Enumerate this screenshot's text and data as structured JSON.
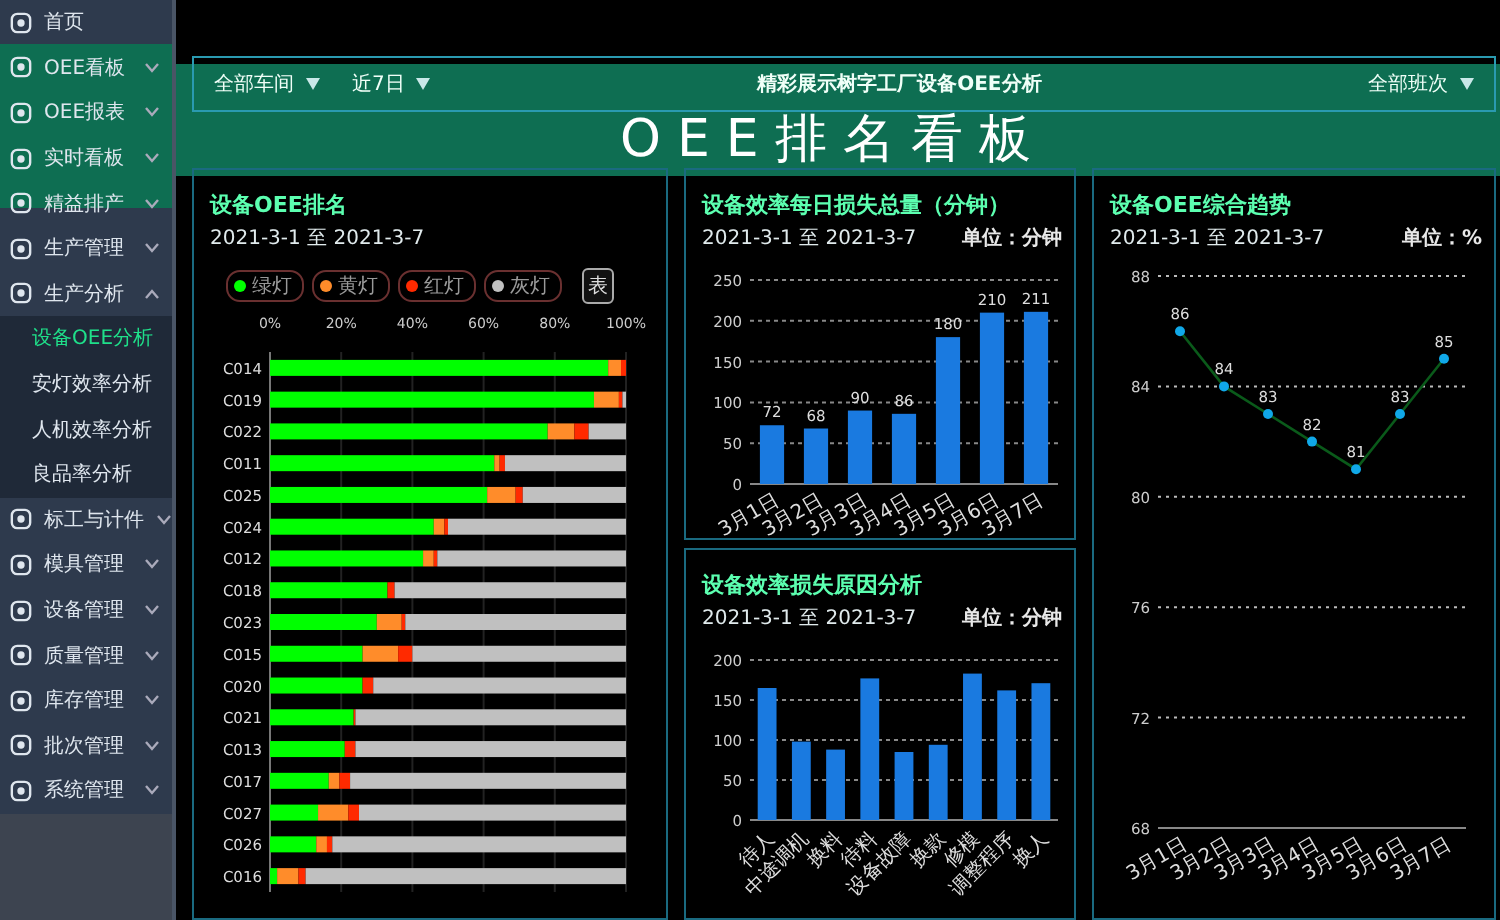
{
  "sidebar": {
    "items": [
      {
        "label": "首页",
        "selected": false
      },
      {
        "label": "OEE看板",
        "selected": false,
        "expanded": false
      },
      {
        "label": "OEE报表",
        "selected": false,
        "expanded": false
      },
      {
        "label": "实时看板",
        "selected": false,
        "expanded": false
      },
      {
        "label": "精益排产",
        "selected": false,
        "expanded": false
      },
      {
        "label": "生产管理",
        "selected": false,
        "expanded": false
      },
      {
        "label": "生产分析",
        "selected": false,
        "expanded": true,
        "children": [
          {
            "label": "设备OEE分析",
            "selected": true
          },
          {
            "label": "安灯效率分析",
            "selected": false
          },
          {
            "label": "人机效率分析",
            "selected": false
          },
          {
            "label": "良品率分析",
            "selected": false
          }
        ]
      },
      {
        "label": "标工与计件",
        "selected": false,
        "expanded": false
      },
      {
        "label": "模具管理",
        "selected": false,
        "expanded": false
      },
      {
        "label": "设备管理",
        "selected": false,
        "expanded": false
      },
      {
        "label": "质量管理",
        "selected": false,
        "expanded": false
      },
      {
        "label": "库存管理",
        "selected": false,
        "expanded": false
      },
      {
        "label": "批次管理",
        "selected": false,
        "expanded": false
      },
      {
        "label": "系统管理",
        "selected": false,
        "expanded": false
      }
    ]
  },
  "banner": {
    "title": "OEE排名看板"
  },
  "header": {
    "filters": [
      {
        "label": "全部车间"
      },
      {
        "label": "近7日"
      }
    ],
    "title": "精彩展示树字工厂设备OEE分析",
    "right_filter": {
      "label": "全部班次"
    }
  },
  "panels": {
    "ranking": {
      "title": "设备OEE排名",
      "date_range": "2021-3-1 至 2021-3-7",
      "table_button": "表",
      "chart_data": {
        "type": "bar",
        "orientation": "horizontal",
        "stacked": true,
        "categories": [
          "C014",
          "C019",
          "C022",
          "C011",
          "C025",
          "C024",
          "C012",
          "C018",
          "C023",
          "C015",
          "C020",
          "C021",
          "C013",
          "C017",
          "C027",
          "C026",
          "C016"
        ],
        "xlim": [
          0,
          100
        ],
        "grid": true,
        "xticks": [
          {
            "value": 0,
            "label": "0%"
          },
          {
            "value": 20,
            "label": "20%"
          },
          {
            "value": 40,
            "label": "40%"
          },
          {
            "value": 60,
            "label": "60%"
          },
          {
            "value": 80,
            "label": "80%"
          },
          {
            "value": 100,
            "label": "100%"
          }
        ],
        "series": [
          {
            "name": "绿灯",
            "color": "#00ff00",
            "values": [
              95,
              91,
              78,
              63,
              61,
              46,
              43,
              33,
              30,
              26,
              26,
              23.5,
              21,
              16.5,
              13.5,
              13,
              2
            ]
          },
          {
            "name": "黄灯",
            "color": "#ff8c2a",
            "values": [
              3.6,
              7,
              7.5,
              1.5,
              8,
              3,
              3,
              0,
              7,
              10,
              0,
              0,
              0,
              3,
              8.5,
              3,
              6
            ]
          },
          {
            "name": "红灯",
            "color": "#ff2a00",
            "values": [
              1.4,
              1,
              4,
              1.5,
              2,
              1,
              1,
              2,
              1,
              4,
              3,
              0.5,
              3,
              3,
              3,
              1.5,
              2
            ]
          },
          {
            "name": "灰灯",
            "color": "#c0c0c0",
            "values": [
              0,
              1,
              10.5,
              34,
              29,
              50,
              53,
              65,
              62,
              60,
              71,
              76,
              76,
              77.5,
              75,
              82.5,
              90
            ]
          }
        ]
      }
    },
    "daily_loss": {
      "title": "设备效率每日损失总量（分钟）",
      "date_range": "2021-3-1 至 2021-3-7",
      "unit": "单位：分钟",
      "chart_data": {
        "type": "bar",
        "categories": [
          "3月1日",
          "3月2日",
          "3月3日",
          "3月4日",
          "3月5日",
          "3月6日",
          "3月7日"
        ],
        "values": [
          72,
          68,
          90,
          86,
          180,
          210,
          211
        ],
        "grid": true,
        "ylim": [
          0,
          250
        ],
        "yticks": [
          0,
          50,
          100,
          150,
          200,
          250
        ],
        "data_labels": true
      }
    },
    "loss_reasons": {
      "title": "设备效率损失原因分析",
      "date_range": "2021-3-1 至 2021-3-7",
      "unit": "单位：分钟",
      "chart_data": {
        "type": "bar",
        "categories": [
          "待人",
          "中途调机",
          "换料",
          "待料",
          "设备故障",
          "换款",
          "修模",
          "调整程序",
          "换人"
        ],
        "values": [
          165,
          98,
          88,
          177,
          85,
          94,
          183,
          162,
          171
        ],
        "grid": true,
        "ylim": [
          0,
          200
        ],
        "yticks": [
          0,
          50,
          100,
          150,
          200
        ]
      }
    },
    "trend": {
      "title": "设备OEE综合趋势",
      "date_range": "2021-3-1 至 2021-3-7",
      "unit": "单位：%",
      "chart_data": {
        "type": "line",
        "categories": [
          "3月1日",
          "3月2日",
          "3月3日",
          "3月4日",
          "3月5日",
          "3月6日",
          "3月7日"
        ],
        "series": [
          {
            "color": "#0a5a1a",
            "marker": "circle",
            "values": [
              86,
              84,
              83,
              82,
              81,
              83,
              85
            ]
          }
        ],
        "grid": true,
        "ylim": [
          68,
          88
        ],
        "yticks": [
          68,
          72,
          76,
          80,
          84,
          88
        ],
        "data_labels": true
      }
    }
  }
}
